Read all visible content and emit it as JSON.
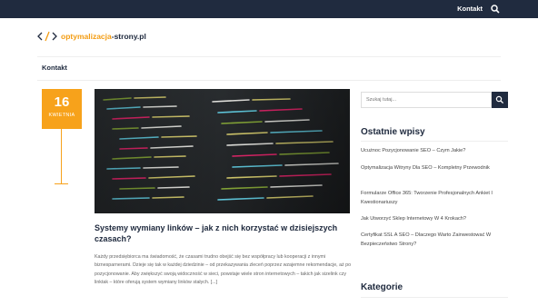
{
  "topbar": {
    "nav_label": "Kontakt",
    "search_icon": "search-icon"
  },
  "header": {
    "logo_icon": "code-bracket-icon",
    "logo_part1": "optymalizacja",
    "logo_part2": "-strony.pl"
  },
  "menu": {
    "item": "Kontakt"
  },
  "post": {
    "date_day": "16",
    "date_month": "KWIETNIA",
    "title": "Systemy wymiany linków – jak z nich korzystać w dzisiejszych czasach?",
    "excerpt": "Każdy przedsiębiorca ma świadomość, że czasami trudno obejść się bez współpracy lub kooperacji z innymi biznesparnerami. Dzieje się tak w każdej dziedzinie – od przekazywania zleceń poprzez wzajemne rekomendacje, aż po pozycjonowanie. Aby zwiększyć swoją widoczność w sieci, powstaje wiele stron internetowych – takich jak sizelink czy linktak – które oferują system wymiany linków stałych. [...]"
  },
  "sidebar": {
    "search_placeholder": "Szukaj tutaj...",
    "recent_title": "Ostatnie wpisy",
    "recent": [
      "Ucużnoc Pozycjonowanie SEO – Czym Jakie?",
      "Optymalizacja Witryny Dla SEO – Kompletny Przewodnik",
      "Formularze Office 365: Tworzenie Profesjonalnych Ankiet I Kwestionariuszy",
      "Jak Utworzyć Sklep Internetowy W 4 Krokach?",
      "Certyfikat SSL A SEO – Dlaczego Warto Zainwestować W Bezpieczeństwo Strony?"
    ],
    "categories_title": "Kategorie"
  },
  "colors": {
    "navy": "#202b3f",
    "orange": "#f7a21b"
  }
}
